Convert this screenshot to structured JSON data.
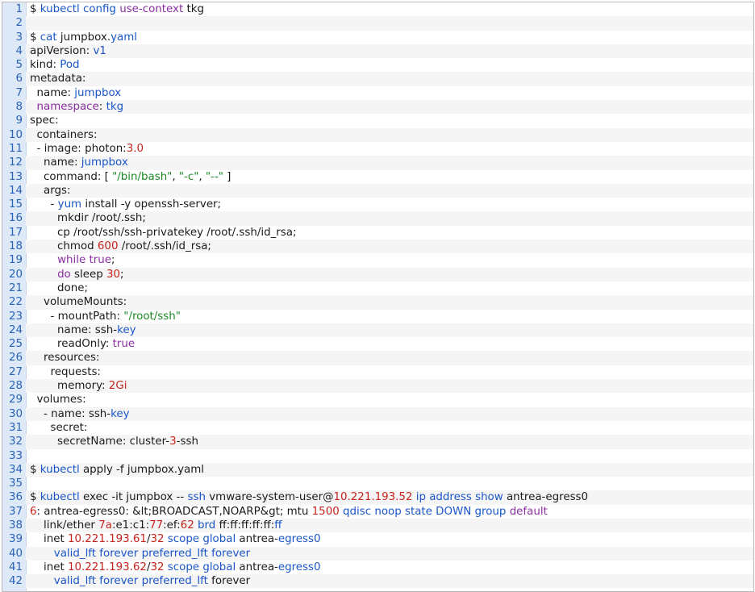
{
  "code": {
    "lines": [
      {
        "no": "1",
        "segments": [
          {
            "t": "$ "
          },
          {
            "t": "kubectl",
            "c": "k"
          },
          {
            "t": " "
          },
          {
            "t": "config",
            "c": "k"
          },
          {
            "t": " "
          },
          {
            "t": "use-context",
            "c": "p"
          },
          {
            "t": " tkg"
          }
        ]
      },
      {
        "no": "2",
        "segments": []
      },
      {
        "no": "3",
        "segments": [
          {
            "t": "$ "
          },
          {
            "t": "cat",
            "c": "k"
          },
          {
            "t": " jumpbox."
          },
          {
            "t": "yaml",
            "c": "k"
          }
        ]
      },
      {
        "no": "4",
        "segments": [
          {
            "t": "apiVersion: "
          },
          {
            "t": "v1",
            "c": "k"
          }
        ]
      },
      {
        "no": "5",
        "segments": [
          {
            "t": "kind: "
          },
          {
            "t": "Pod",
            "c": "k"
          }
        ]
      },
      {
        "no": "6",
        "segments": [
          {
            "t": "metadata:"
          }
        ]
      },
      {
        "no": "7",
        "segments": [
          {
            "t": "  name: "
          },
          {
            "t": "jumpbox",
            "c": "k"
          }
        ]
      },
      {
        "no": "8",
        "segments": [
          {
            "t": "  "
          },
          {
            "t": "namespace",
            "c": "p"
          },
          {
            "t": ": "
          },
          {
            "t": "tkg",
            "c": "k"
          }
        ]
      },
      {
        "no": "9",
        "segments": [
          {
            "t": "spec:"
          }
        ]
      },
      {
        "no": "10",
        "segments": [
          {
            "t": "  containers:"
          }
        ]
      },
      {
        "no": "11",
        "segments": [
          {
            "t": "  - image: photon:"
          },
          {
            "t": "3.0",
            "c": "n"
          }
        ]
      },
      {
        "no": "12",
        "segments": [
          {
            "t": "    name: "
          },
          {
            "t": "jumpbox",
            "c": "k"
          }
        ]
      },
      {
        "no": "13",
        "segments": [
          {
            "t": "    command: [ "
          },
          {
            "t": "\"/bin/bash\"",
            "c": "s"
          },
          {
            "t": ", "
          },
          {
            "t": "\"-c\"",
            "c": "s"
          },
          {
            "t": ", "
          },
          {
            "t": "\"--\"",
            "c": "s"
          },
          {
            "t": " ]"
          }
        ]
      },
      {
        "no": "14",
        "segments": [
          {
            "t": "    args:"
          }
        ]
      },
      {
        "no": "15",
        "segments": [
          {
            "t": "      - "
          },
          {
            "t": "yum",
            "c": "k"
          },
          {
            "t": " install -y openssh-server;"
          }
        ]
      },
      {
        "no": "16",
        "segments": [
          {
            "t": "        mkdir /root/.ssh;"
          }
        ]
      },
      {
        "no": "17",
        "segments": [
          {
            "t": "        cp /root/ssh/ssh-privatekey /root/.ssh/id_rsa;"
          }
        ]
      },
      {
        "no": "18",
        "segments": [
          {
            "t": "        chmod "
          },
          {
            "t": "600",
            "c": "n"
          },
          {
            "t": " /root/.ssh/id_rsa;"
          }
        ]
      },
      {
        "no": "19",
        "segments": [
          {
            "t": "        "
          },
          {
            "t": "while",
            "c": "p"
          },
          {
            "t": " "
          },
          {
            "t": "true",
            "c": "p"
          },
          {
            "t": ";"
          }
        ]
      },
      {
        "no": "20",
        "segments": [
          {
            "t": "        "
          },
          {
            "t": "do",
            "c": "p"
          },
          {
            "t": " sleep "
          },
          {
            "t": "30",
            "c": "n"
          },
          {
            "t": ";"
          }
        ]
      },
      {
        "no": "21",
        "segments": [
          {
            "t": "        done;"
          }
        ]
      },
      {
        "no": "22",
        "segments": [
          {
            "t": "    volumeMounts:"
          }
        ]
      },
      {
        "no": "23",
        "segments": [
          {
            "t": "      - mountPath: "
          },
          {
            "t": "\"/root/ssh\"",
            "c": "s"
          }
        ]
      },
      {
        "no": "24",
        "segments": [
          {
            "t": "        name: ssh-"
          },
          {
            "t": "key",
            "c": "k"
          }
        ]
      },
      {
        "no": "25",
        "segments": [
          {
            "t": "        readOnly: "
          },
          {
            "t": "true",
            "c": "p"
          }
        ]
      },
      {
        "no": "26",
        "segments": [
          {
            "t": "    resources:"
          }
        ]
      },
      {
        "no": "27",
        "segments": [
          {
            "t": "      requests:"
          }
        ]
      },
      {
        "no": "28",
        "segments": [
          {
            "t": "        memory: "
          },
          {
            "t": "2Gi",
            "c": "n"
          }
        ]
      },
      {
        "no": "29",
        "segments": [
          {
            "t": "  volumes:"
          }
        ]
      },
      {
        "no": "30",
        "segments": [
          {
            "t": "    - name: ssh-"
          },
          {
            "t": "key",
            "c": "k"
          }
        ]
      },
      {
        "no": "31",
        "segments": [
          {
            "t": "      secret:"
          }
        ]
      },
      {
        "no": "32",
        "segments": [
          {
            "t": "        secretName: cluster-"
          },
          {
            "t": "3",
            "c": "n"
          },
          {
            "t": "-ssh"
          }
        ]
      },
      {
        "no": "33",
        "segments": []
      },
      {
        "no": "34",
        "segments": [
          {
            "t": "$ "
          },
          {
            "t": "kubectl",
            "c": "k"
          },
          {
            "t": " apply -f jumpbox.yaml"
          }
        ]
      },
      {
        "no": "35",
        "segments": []
      },
      {
        "no": "36",
        "segments": [
          {
            "t": "$ "
          },
          {
            "t": "kubectl",
            "c": "k"
          },
          {
            "t": " exec -it jumpbox -- "
          },
          {
            "t": "ssh",
            "c": "k"
          },
          {
            "t": " vmware-system-user@"
          },
          {
            "t": "10.221.193.52",
            "c": "n"
          },
          {
            "t": " "
          },
          {
            "t": "ip",
            "c": "k"
          },
          {
            "t": " "
          },
          {
            "t": "address",
            "c": "k"
          },
          {
            "t": " "
          },
          {
            "t": "show",
            "c": "k"
          },
          {
            "t": " antrea-egress0"
          }
        ]
      },
      {
        "no": "37",
        "segments": [
          {
            "t": "6",
            "c": "n"
          },
          {
            "t": ": antrea-egress0: &lt;BROADCAST,NOARP&gt; mtu "
          },
          {
            "t": "1500",
            "c": "n"
          },
          {
            "t": " "
          },
          {
            "t": "qdisc",
            "c": "k"
          },
          {
            "t": " "
          },
          {
            "t": "noop",
            "c": "k"
          },
          {
            "t": " "
          },
          {
            "t": "state",
            "c": "k"
          },
          {
            "t": " "
          },
          {
            "t": "DOWN",
            "c": "k"
          },
          {
            "t": " "
          },
          {
            "t": "group",
            "c": "k"
          },
          {
            "t": " "
          },
          {
            "t": "default",
            "c": "p"
          }
        ]
      },
      {
        "no": "38",
        "segments": [
          {
            "t": "    link/ether "
          },
          {
            "t": "7a",
            "c": "n"
          },
          {
            "t": ":e1:c1:"
          },
          {
            "t": "77",
            "c": "n"
          },
          {
            "t": ":ef:"
          },
          {
            "t": "62",
            "c": "n"
          },
          {
            "t": " "
          },
          {
            "t": "brd",
            "c": "k"
          },
          {
            "t": " ff:ff:ff:ff:ff:"
          },
          {
            "t": "ff",
            "c": "k"
          }
        ]
      },
      {
        "no": "39",
        "segments": [
          {
            "t": "    inet "
          },
          {
            "t": "10.221.193.61",
            "c": "n"
          },
          {
            "t": "/"
          },
          {
            "t": "32",
            "c": "n"
          },
          {
            "t": " "
          },
          {
            "t": "scope",
            "c": "k"
          },
          {
            "t": " "
          },
          {
            "t": "global",
            "c": "k"
          },
          {
            "t": " antrea-"
          },
          {
            "t": "egress0",
            "c": "k"
          }
        ]
      },
      {
        "no": "40",
        "segments": [
          {
            "t": "       "
          },
          {
            "t": "valid_lft",
            "c": "k"
          },
          {
            "t": " "
          },
          {
            "t": "forever",
            "c": "k"
          },
          {
            "t": " "
          },
          {
            "t": "preferred_lft",
            "c": "k"
          },
          {
            "t": " "
          },
          {
            "t": "forever",
            "c": "k"
          }
        ]
      },
      {
        "no": "41",
        "segments": [
          {
            "t": "    inet "
          },
          {
            "t": "10.221.193.62",
            "c": "n"
          },
          {
            "t": "/"
          },
          {
            "t": "32",
            "c": "n"
          },
          {
            "t": " "
          },
          {
            "t": "scope",
            "c": "k"
          },
          {
            "t": " "
          },
          {
            "t": "global",
            "c": "k"
          },
          {
            "t": " antrea-"
          },
          {
            "t": "egress0",
            "c": "k"
          }
        ]
      },
      {
        "no": "42",
        "segments": [
          {
            "t": "       "
          },
          {
            "t": "valid_lft",
            "c": "k"
          },
          {
            "t": " "
          },
          {
            "t": "forever",
            "c": "k"
          },
          {
            "t": " "
          },
          {
            "t": "preferred_lft",
            "c": "k"
          },
          {
            "t": " forever"
          }
        ]
      }
    ]
  }
}
